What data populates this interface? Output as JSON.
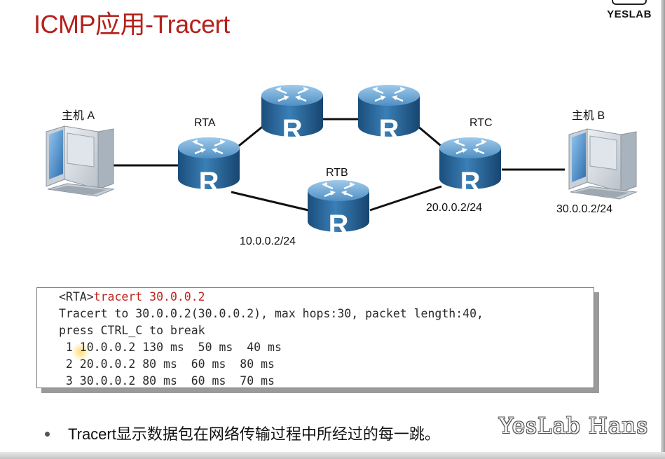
{
  "title": "ICMP应用-Tracert",
  "logo": {
    "text": "YESLAB"
  },
  "diagram": {
    "host_a": {
      "label": "主机 A"
    },
    "host_b": {
      "label": "主机 B",
      "ip": "30.0.0.2/24"
    },
    "rta": {
      "label": "RTA",
      "router_letter": "R"
    },
    "rtb": {
      "label": "RTB",
      "router_letter": "R",
      "ip": "10.0.0.2/24"
    },
    "rtc": {
      "label": "RTC",
      "router_letter": "R",
      "ip": "20.0.0.2/24"
    },
    "upper_left_router": {
      "router_letter": "R"
    },
    "upper_right_router": {
      "router_letter": "R"
    }
  },
  "cli": {
    "prompt": "<RTA>",
    "command": "tracert 30.0.0.2",
    "line2": "Tracert to 30.0.0.2(30.0.0.2), max hops:30, packet length:40,",
    "line3": "press CTRL_C to break",
    "hops": [
      " 1 10.0.0.2 130 ms  50 ms  40 ms",
      " 2 20.0.0.2 80 ms  60 ms  80 ms",
      " 3 30.0.0.2 80 ms  60 ms  70 ms"
    ]
  },
  "bullet": {
    "text": "Tracert显示数据包在网络传输过程中所经过的每一跳。"
  },
  "watermark": {
    "text": "YesLab Hans"
  }
}
